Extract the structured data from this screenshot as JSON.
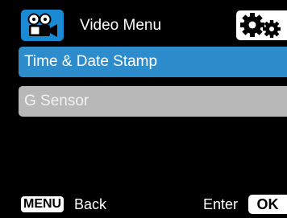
{
  "header": {
    "title": "Video Menu",
    "video_tab_icon": "video-camera-icon",
    "settings_tab_icon": "gears-icon"
  },
  "menu": {
    "items": [
      {
        "label": "Time & Date Stamp",
        "selected": true
      },
      {
        "label": "G Sensor",
        "selected": false
      }
    ]
  },
  "footer": {
    "menu_key": "MENU",
    "back_label": "Back",
    "enter_label": "Enter",
    "ok_key": "OK"
  },
  "colors": {
    "background": "#000000",
    "accent": "#2d8ccc",
    "tab_icon_bg": "#1a8ad4",
    "inactive_item": "#b8b8b8",
    "text": "#ffffff"
  }
}
